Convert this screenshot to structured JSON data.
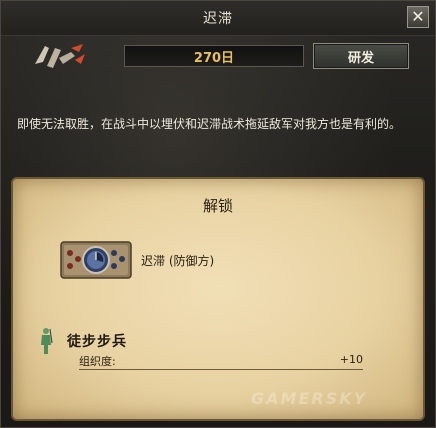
{
  "window": {
    "title": "迟滞"
  },
  "research": {
    "days_value": "270日",
    "button_label": "研发"
  },
  "description": "即使无法取胜，在战斗中以埋伏和迟滞战术拖延敌军对我方也是有利的。",
  "unlock": {
    "title": "解锁",
    "tactic_label": "迟滞 (防御方)"
  },
  "unit": {
    "name": "徒步步兵",
    "stat_label": "组织度:",
    "stat_value": "+10"
  },
  "watermark": "GAMERSKY",
  "colors": {
    "days_text": "#e9c15a",
    "parchment": "#e8d2a2",
    "dark_panel": "#1f1e1b"
  }
}
